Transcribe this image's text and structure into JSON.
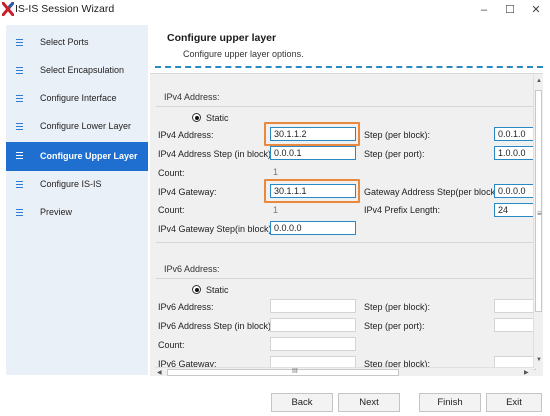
{
  "window": {
    "title": "IS-IS Session Wizard",
    "logo": "x-logo-icon",
    "controls": {
      "minimize": "–",
      "maximize": "☐",
      "close": "✕"
    }
  },
  "sidebar": {
    "items": [
      {
        "label": "Select Ports",
        "icon": "menu-icon"
      },
      {
        "label": "Select Encapsulation",
        "icon": "menu-icon"
      },
      {
        "label": "Configure Interface",
        "icon": "menu-icon"
      },
      {
        "label": "Configure Lower Layer",
        "icon": "menu-icon"
      },
      {
        "label": "Configure Upper Layer",
        "icon": "menu-icon",
        "active": true
      },
      {
        "label": "Configure IS-IS",
        "icon": "menu-icon"
      },
      {
        "label": "Preview",
        "icon": "menu-icon"
      }
    ]
  },
  "header": {
    "title": "Configure upper layer",
    "subtitle": "Configure upper layer options."
  },
  "ipv4": {
    "group_label": "IPv4 Address:",
    "mode_label": "Static",
    "address_label": "IPv4 Address:",
    "address_value": "30.1.1.2",
    "step_block_label": "Step (per block):",
    "step_block_value": "0.0.1.0",
    "address_step_label": "IPv4 Address Step (in block):",
    "address_step_value": "0.0.0.1",
    "step_port_label": "Step (per port):",
    "step_port_value": "1.0.0.0",
    "count_label": "Count:",
    "count_value": "1",
    "gateway_label": "IPv4 Gateway:",
    "gateway_value": "30.1.1.1",
    "gateway_step_block_label": "Gateway Address Step(per block)",
    "gateway_step_block_value": "0.0.0.0",
    "count2_label": "Count:",
    "count2_value": "1",
    "prefix_label": "IPv4 Prefix Length:",
    "prefix_value": "24",
    "gateway_step_label": "IPv4 Gateway Step(in block)",
    "gateway_step_value": "0.0.0.0"
  },
  "ipv6": {
    "group_label": "IPv6 Address:",
    "mode_label": "Static",
    "address_label": "IPv6 Address:",
    "address_value": "",
    "step_block_label": "Step (per block):",
    "step_block_value": "",
    "address_step_label": "IPv6 Address Step (in block):",
    "address_step_value": "",
    "step_port_label": "Step (per port):",
    "step_port_value": "",
    "count_label": "Count:",
    "count_value": "",
    "gateway_label": "IPv6 Gateway:",
    "gateway_value": "",
    "gateway_step_block_label": "Step (per block):",
    "gateway_step_block_value": ""
  },
  "scrollbar": {
    "grip": "≡",
    "hgrip": "III",
    "up": "▲",
    "down": "▼",
    "left": "◀",
    "right": "▶"
  },
  "buttons": {
    "back": "Back",
    "next": "Next",
    "finish": "Finish",
    "exit": "Exit"
  },
  "colors": {
    "accent": "#1f6fd1",
    "field_border": "#2a88c2",
    "highlight": "#e8893d",
    "sidebar_bg": "#eaf0f7"
  }
}
